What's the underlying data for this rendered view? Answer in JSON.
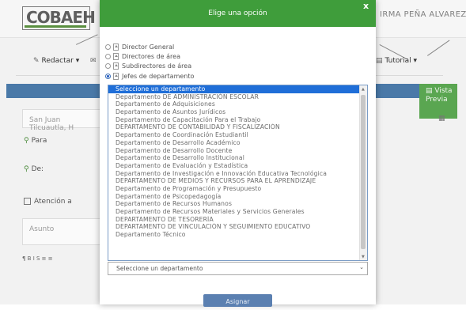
{
  "app": {
    "logo_text": "COBAEH",
    "user_name": "IRMA PEÑA ALVAREZ",
    "toolbar": {
      "compose_label": "Redactar",
      "tutorial_label": "Tutorial"
    },
    "preview_label": "Vista Previa",
    "location_value": "San Juan Tilcuautla, H",
    "para_label": "Para",
    "de_label": "De:",
    "attention_label": "Atención a",
    "subject_placeholder": "Asunto",
    "editor_tools": "¶  B  I  S  ≡  ≡"
  },
  "modal": {
    "title": "Elige una opción",
    "close_label": "x",
    "radio_options": [
      {
        "label": "Director General",
        "checked": false
      },
      {
        "label": "Directores de área",
        "checked": false
      },
      {
        "label": "Subdirectores de área",
        "checked": false
      },
      {
        "label": "Jefes de departamento",
        "checked": true
      }
    ],
    "departments": [
      "Seleccione un departamento",
      "Departamento DE ADMINISTRACIÓN ESCOLAR",
      "Departamento de Adquisiciones",
      "Departamento de Asuntos Jurídicos",
      "Departamento de Capacitación Para el Trabajo",
      "DEPARTAMENTO DE CONTABILIDAD Y FISCALIZACIÓN",
      "Departamento de Coordinación Estudiantil",
      "Departamento de Desarrollo Académico",
      "Departamento de Desarrollo Docente",
      "Departamento de Desarrollo Institucional",
      "Departamento de Evaluación y Estadística",
      "Departamento de Investigación e Innovación Educativa Tecnológica",
      "DEPARTAMENTO DE MEDIOS Y RECURSOS PARA EL APRENDIZAJE",
      "Departamento de Programación y Presupuesto",
      "Departamento de Psicopedagogía",
      "Departamento de Recursos Humanos",
      "Departamento de Recursos Materiales y Servicios Generales",
      "DEPARTAMENTO DE TESORERÍA",
      "DEPARTAMENTO DE VINCULACIÓN Y SEGUIMIENTO EDUCATIVO",
      "Departamento Técnico"
    ],
    "selected_department": "Seleccione un departamento",
    "assign_label": "Asignar"
  }
}
